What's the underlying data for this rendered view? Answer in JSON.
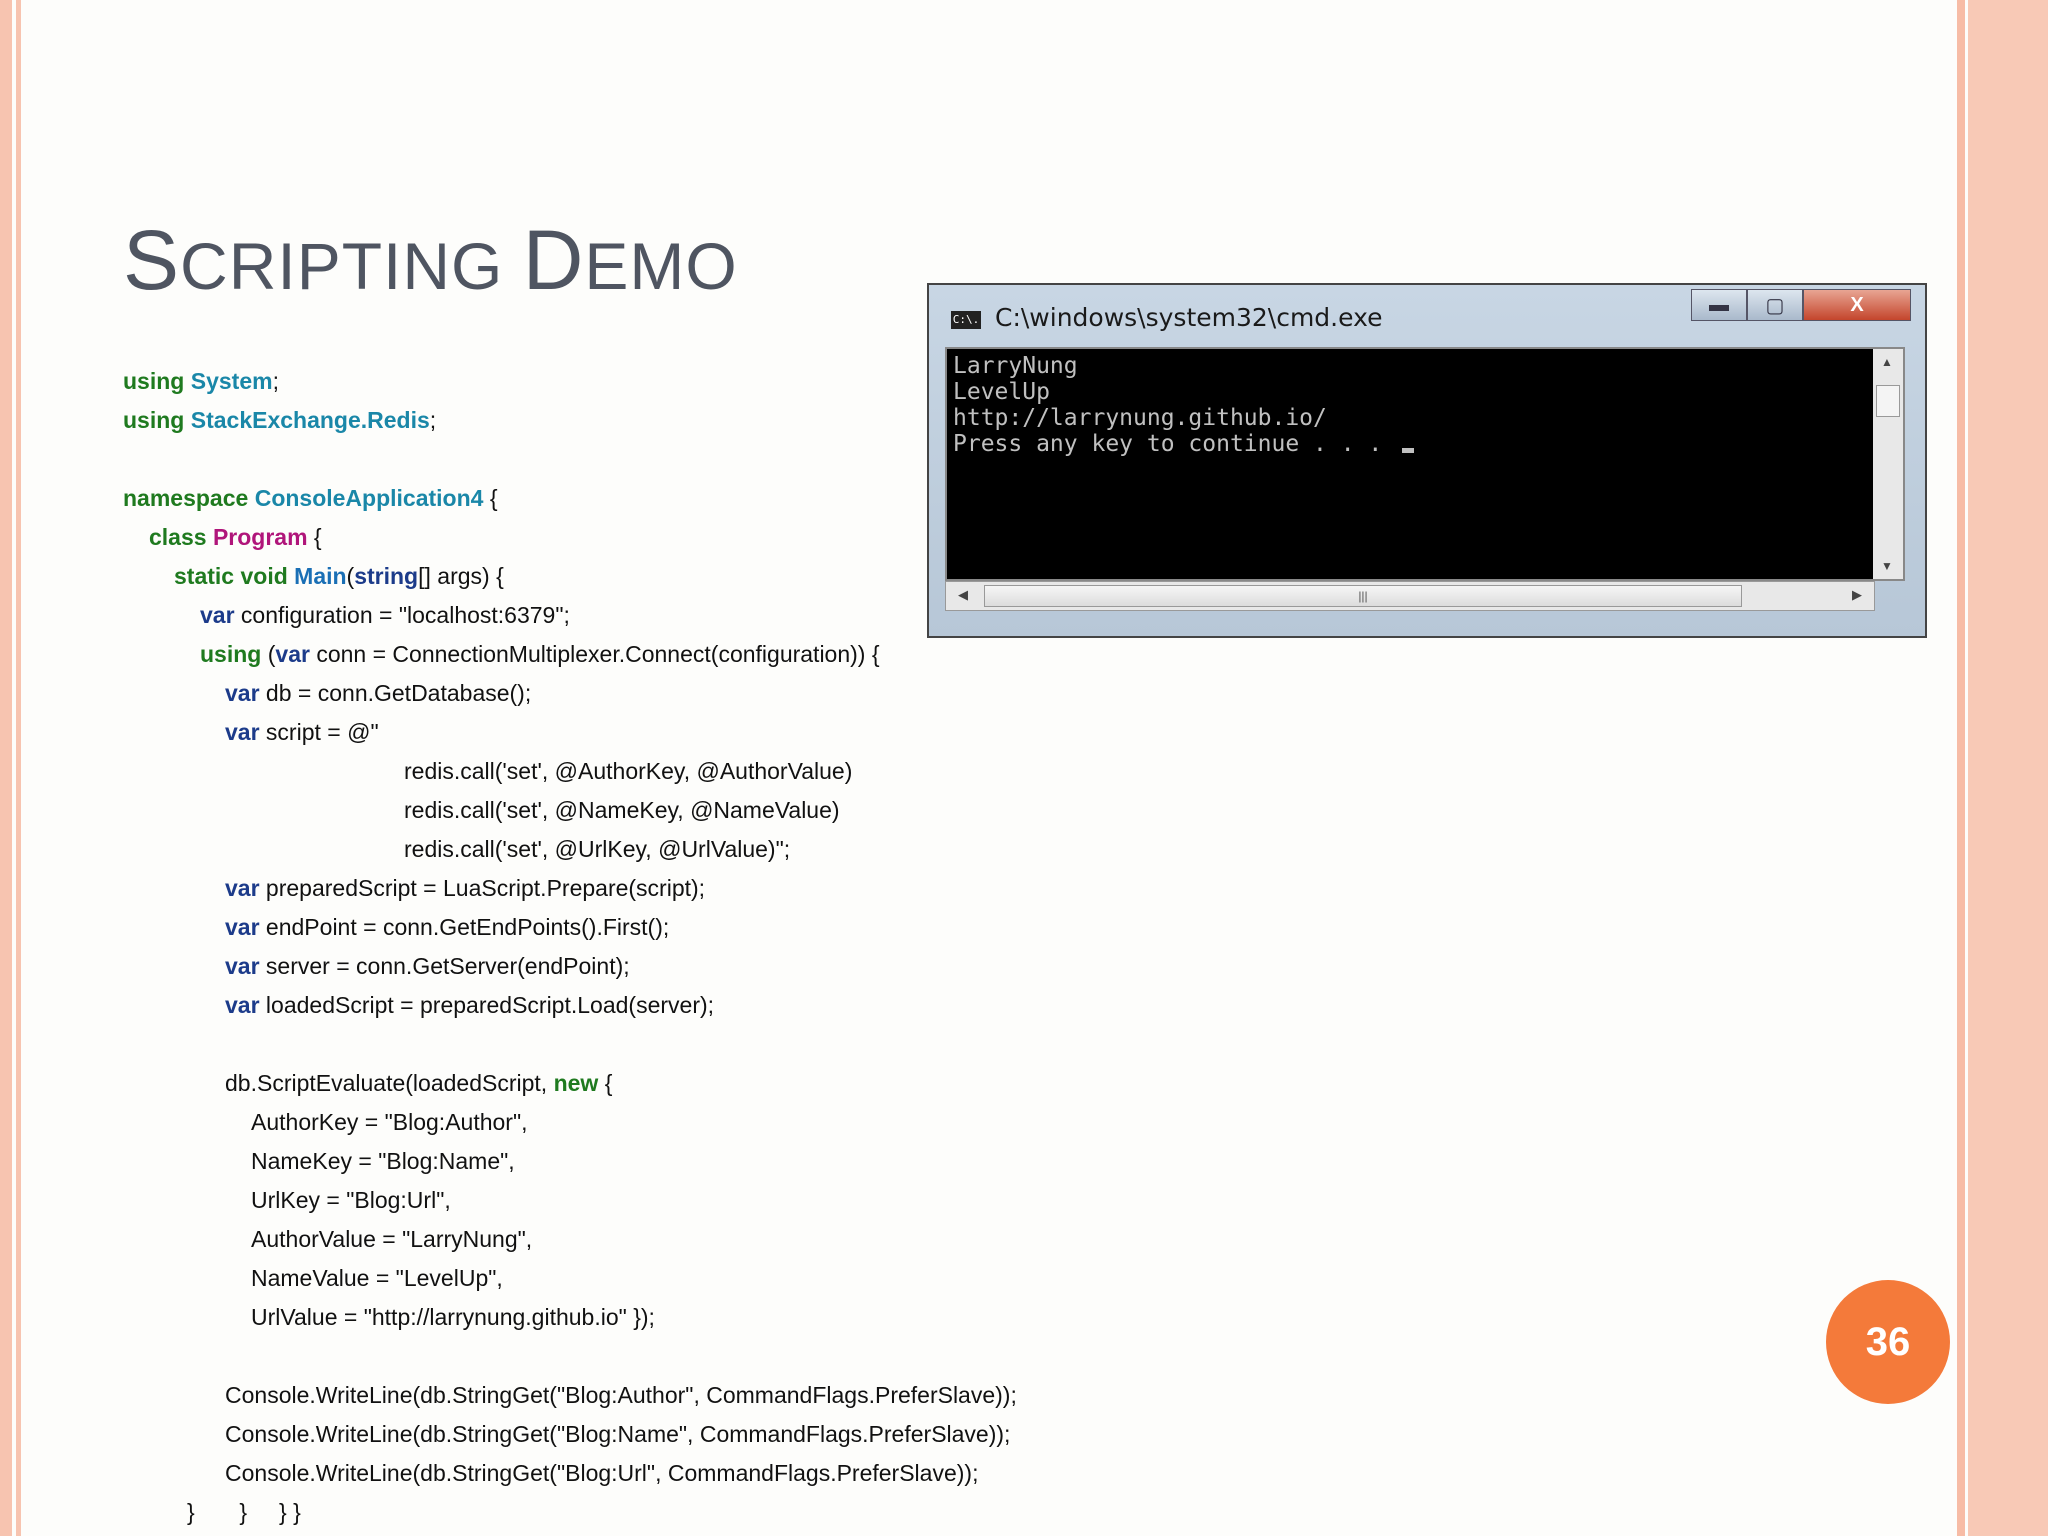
{
  "slide": {
    "title_first": "S",
    "title_rest": "CRIPTING ",
    "title_first2": "D",
    "title_rest2": "EMO",
    "page_number": "36"
  },
  "code": {
    "l1": {
      "k": "using",
      "t": "System",
      "r": ";"
    },
    "l2": {
      "k": "using",
      "t": "StackExchange.Redis",
      "r": ";"
    },
    "l4": {
      "k": "namespace",
      "t": "ConsoleApplication4",
      "r": " {"
    },
    "l5": {
      "k": "class",
      "t": "Program",
      "r": " {"
    },
    "l6": {
      "k": "static void",
      "f": "Main",
      "p1": "(",
      "s": "string",
      "r": "[] args) {"
    },
    "l7": {
      "k": "var",
      "r": " configuration = \"localhost:6379\";"
    },
    "l8": {
      "k": "using",
      "p1": " (",
      "k2": "var",
      "r": " conn = ConnectionMultiplexer.Connect(configuration)) {"
    },
    "l9": {
      "k": "var",
      "r": " db = conn.GetDatabase();"
    },
    "l10": {
      "k": "var",
      "r": " script = @\""
    },
    "l11": "redis.call('set', @AuthorKey, @AuthorValue)",
    "l12": "redis.call('set', @NameKey, @NameValue)",
    "l13": "redis.call('set', @UrlKey, @UrlValue)\";",
    "l14": {
      "k": "var",
      "r": " preparedScript = LuaScript.Prepare(script);"
    },
    "l15": {
      "k": "var",
      "r": " endPoint = conn.GetEndPoints().First();"
    },
    "l16": {
      "k": "var",
      "r": " server = conn.GetServer(endPoint);"
    },
    "l17": {
      "k": "var",
      "r": " loadedScript = preparedScript.Load(server);"
    },
    "l19": {
      "a": "db.ScriptEvaluate(loadedScript, ",
      "k": "new",
      "r": " {"
    },
    "l20": "AuthorKey = \"Blog:Author\",",
    "l21": "NameKey = \"Blog:Name\",",
    "l22": "UrlKey = \"Blog:Url\",",
    "l23": "AuthorValue = \"LarryNung\",",
    "l24": "NameValue = \"LevelUp\",",
    "l25": "UrlValue = \"http://larrynung.github.io\" });",
    "l27": "Console.WriteLine(db.StringGet(\"Blog:Author\", CommandFlags.PreferSlave));",
    "l28": "Console.WriteLine(db.StringGet(\"Blog:Name\", CommandFlags.PreferSlave));",
    "l29": "Console.WriteLine(db.StringGet(\"Blog:Url\", CommandFlags.PreferSlave));",
    "l30": "}       }     } }"
  },
  "console_window": {
    "icon_text": "C:\\.",
    "title": "C:\\windows\\system32\\cmd.exe",
    "min_symbol": "▬",
    "max_symbol": "▢",
    "close_symbol": "X",
    "lines": [
      "LarryNung",
      "LevelUp",
      "http://larrynung.github.io/",
      "Press any key to continue . . . "
    ],
    "scroll_up": "▲",
    "scroll_down": "▼",
    "scroll_left": "◀",
    "scroll_right": "▶",
    "grip": "|||"
  }
}
